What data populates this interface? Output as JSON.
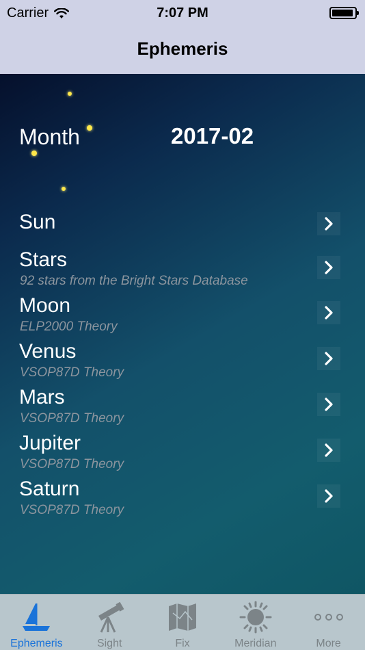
{
  "status_bar": {
    "carrier": "Carrier",
    "time": "7:07 PM"
  },
  "nav": {
    "title": "Ephemeris"
  },
  "month": {
    "label": "Month",
    "value": "2017-02"
  },
  "rows": [
    {
      "title": "Sun",
      "subtitle": ""
    },
    {
      "title": "Stars",
      "subtitle": "92 stars from the Bright Stars Database"
    },
    {
      "title": "Moon",
      "subtitle": "ELP2000 Theory"
    },
    {
      "title": "Venus",
      "subtitle": "VSOP87D Theory"
    },
    {
      "title": "Mars",
      "subtitle": "VSOP87D Theory"
    },
    {
      "title": "Jupiter",
      "subtitle": "VSOP87D Theory"
    },
    {
      "title": "Saturn",
      "subtitle": "VSOP87D Theory"
    }
  ],
  "tabs": [
    {
      "label": "Ephemeris",
      "icon": "sailboat-icon",
      "active": true
    },
    {
      "label": "Sight",
      "icon": "telescope-icon",
      "active": false
    },
    {
      "label": "Fix",
      "icon": "map-icon",
      "active": false
    },
    {
      "label": "Meridian",
      "icon": "sun-icon",
      "active": false
    },
    {
      "label": "More",
      "icon": "more-dots-icon",
      "active": false
    }
  ],
  "colors": {
    "accent": "#1a73d9",
    "bar_background": "#cfd2e6",
    "tab_background": "#b8c6cc"
  }
}
